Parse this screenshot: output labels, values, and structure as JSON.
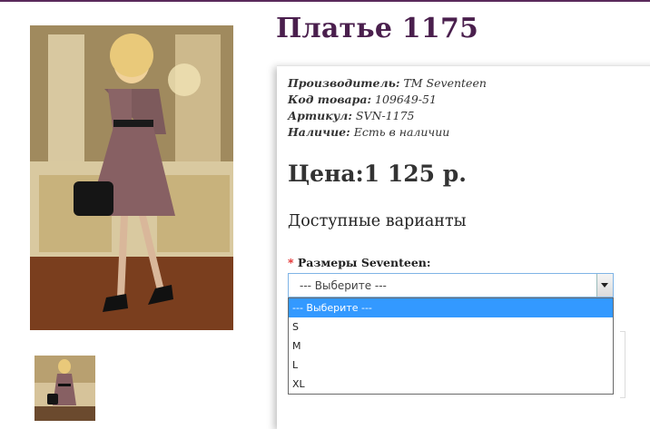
{
  "product": {
    "title": "Платье 1175",
    "meta": [
      {
        "key": "Производитель:",
        "value": " TM Seventeen"
      },
      {
        "key": "Код товара:",
        "value": " 109649-51"
      },
      {
        "key": "Артикул:",
        "value": " SVN-1175"
      },
      {
        "key": "Наличие:",
        "value": " Есть в наличии"
      }
    ],
    "price": "Цена:1 125 р."
  },
  "variants": {
    "title": "Доступные варианты",
    "size_required_mark": "*",
    "size_label": "Размеры Seventeen:",
    "size_selected": "--- Выберите ---",
    "size_options": [
      "--- Выберите ---",
      "S",
      "M",
      "L",
      "XL"
    ]
  },
  "colors": {
    "title": "#4a1f4d",
    "accent_rule": "#5a2a5c",
    "dropdown_highlight": "#3399ff"
  }
}
